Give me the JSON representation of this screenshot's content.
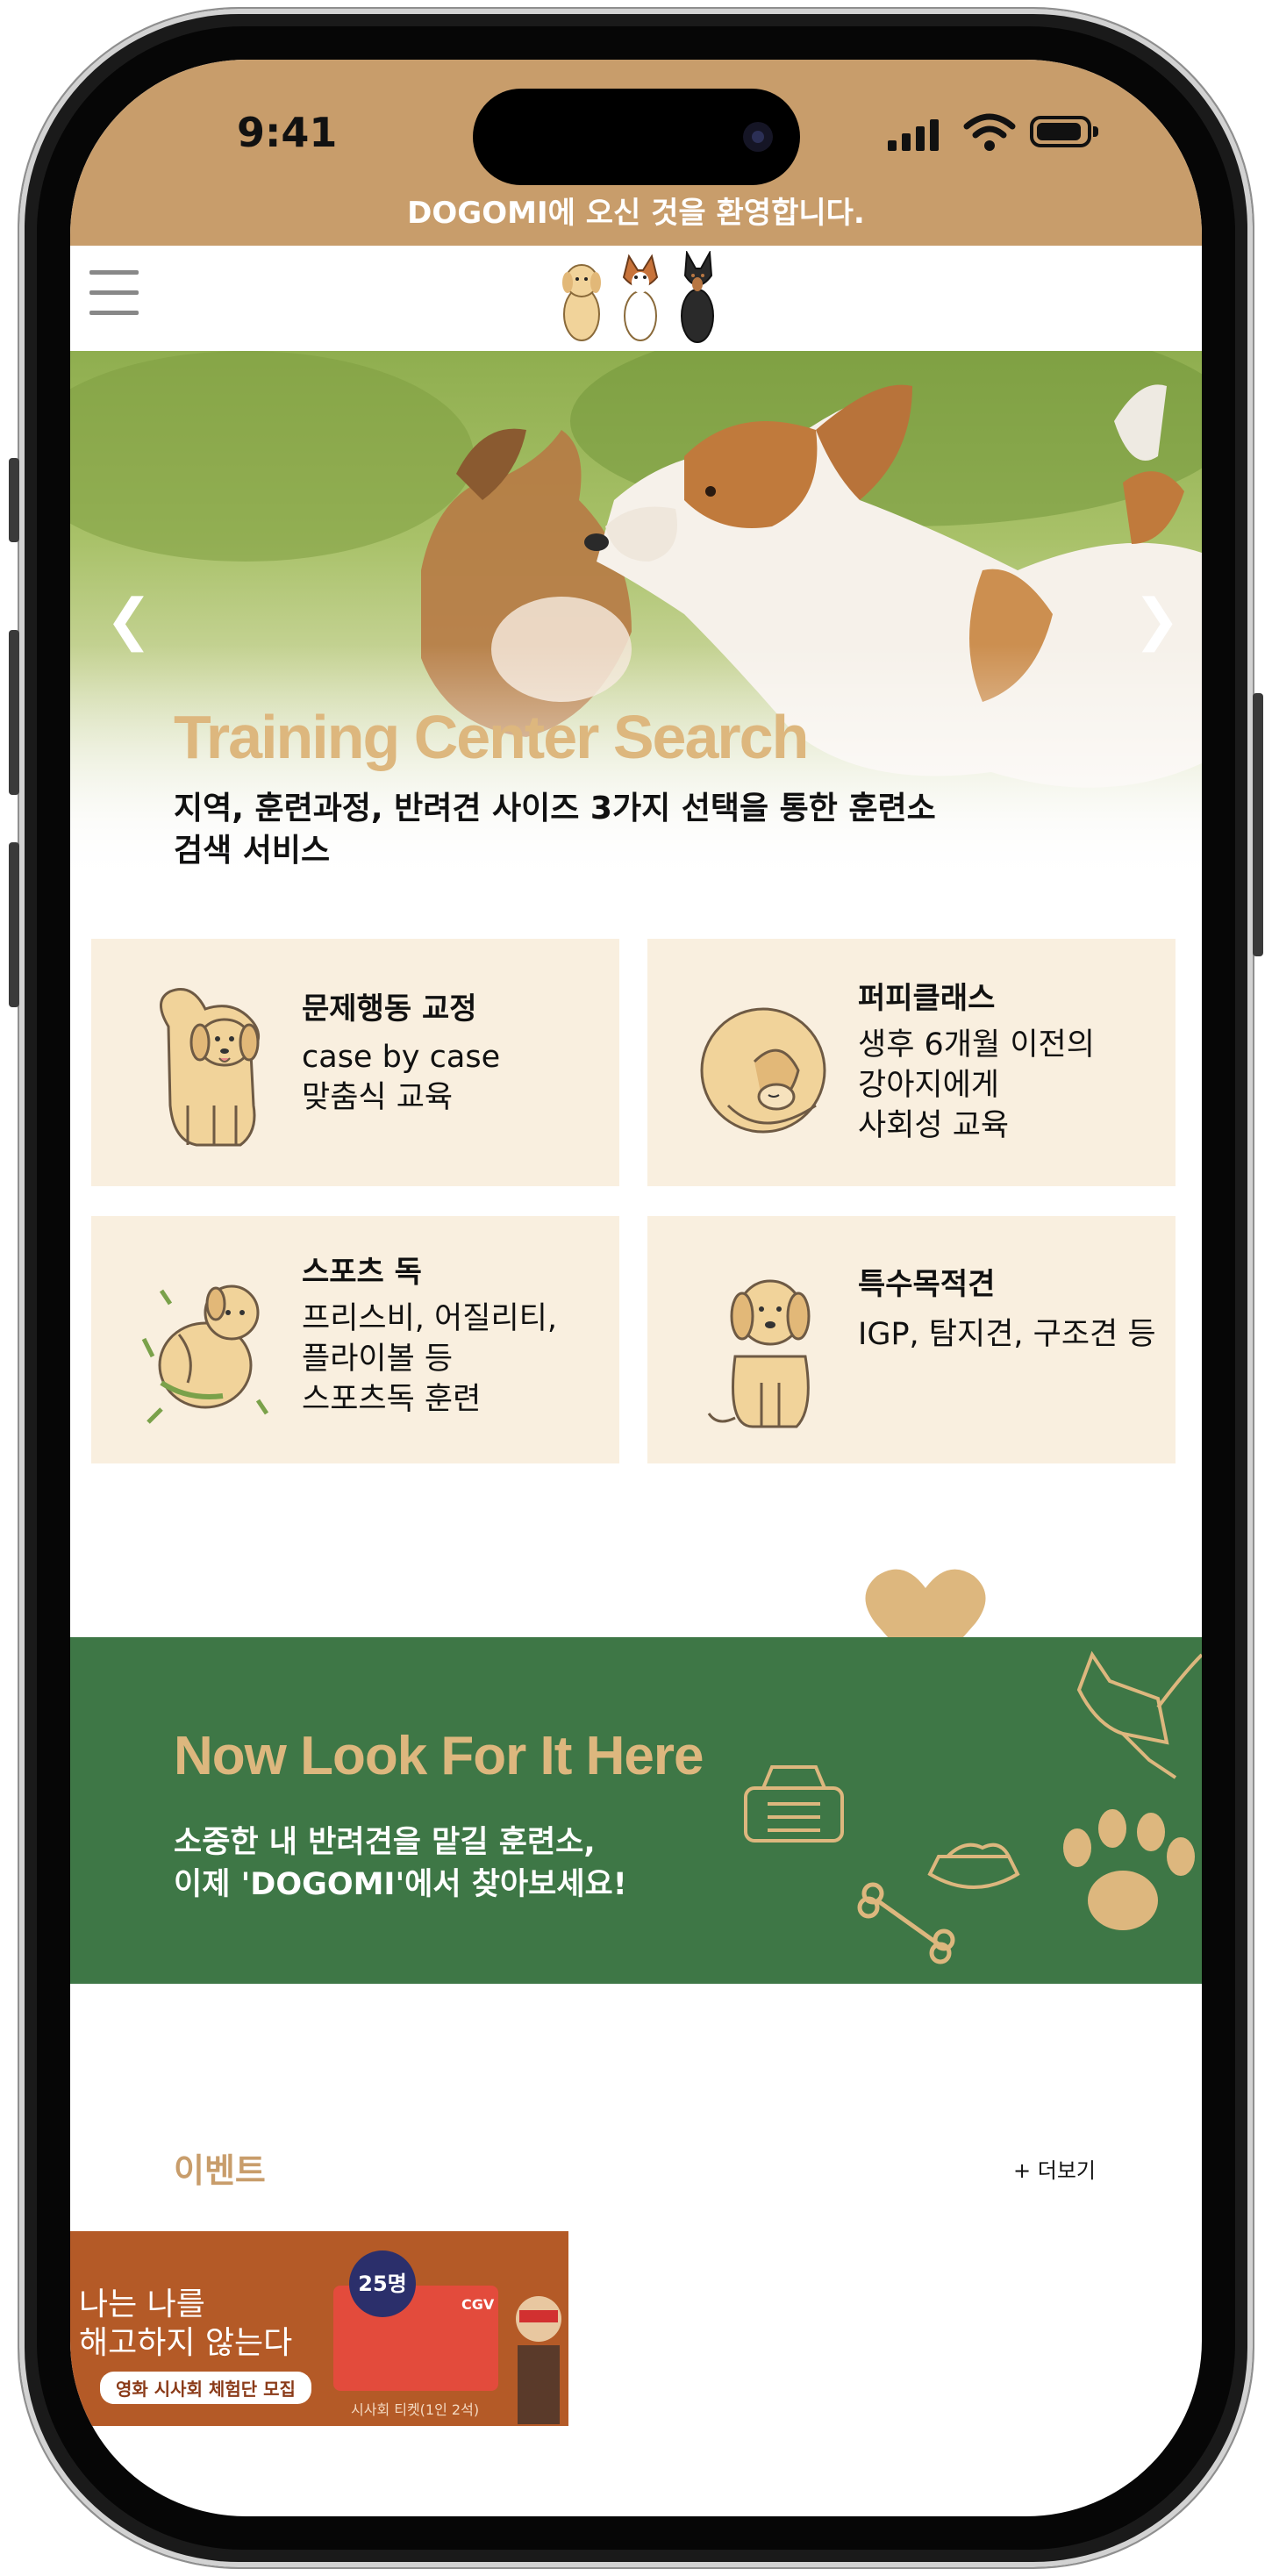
{
  "status_bar": {
    "time": "9:41"
  },
  "top_banner": {
    "text": "DOGOMI에 오신 것을 환영합니다."
  },
  "hero": {
    "title": "Training Center Search",
    "description": "지역, 훈련과정, 반려견 사이즈 3가지 선택을 통한 훈련소 검색 서비스",
    "prev_arrow": "❮",
    "next_arrow": "❯"
  },
  "categories": [
    {
      "title": "문제행동 교정",
      "desc": "case by case\n맞춤식 교육",
      "icon": "standing-dog-icon"
    },
    {
      "title": "퍼피클래스",
      "desc": "생후 6개월 이전의\n강아지에게\n사회성 교육",
      "icon": "curled-puppy-icon"
    },
    {
      "title": "스포츠 독",
      "desc": "프리스비, 어질리티,\n플라이볼 등\n스포츠독 훈련",
      "icon": "rolling-dog-icon"
    },
    {
      "title": "특수목적견",
      "desc": "IGP, 탐지견, 구조견 등",
      "icon": "sitting-dog-icon"
    }
  ],
  "promo": {
    "title": "Now Look For It Here",
    "description": "소중한 내 반려견을 맡길 훈련소,\n이제 'DOGOMI'에서 찾아보세요!"
  },
  "events": {
    "title": "이벤트",
    "more_label": "+ 더보기",
    "banner": {
      "headline": "나는 나를\n해고하지 않는다",
      "tag": "영화 시사회 체험단 모집",
      "badge": "25명",
      "brand": "CGV",
      "caption": "시사회 티켓(1인 2석)"
    }
  },
  "colors": {
    "accent": "#c89d6b",
    "promo_bg": "#3e7746",
    "card_bg": "#f9efdf",
    "gold": "#ddb77e"
  }
}
